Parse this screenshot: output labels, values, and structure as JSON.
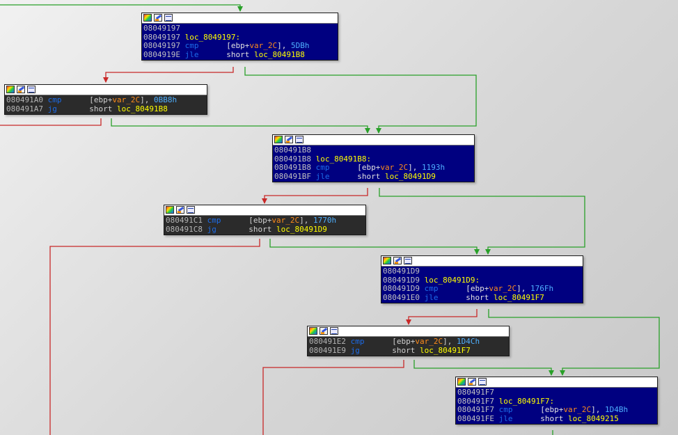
{
  "colors": {
    "true_edge": "#28a028",
    "false_edge": "#c82828",
    "node_blue": "#000080",
    "node_dark": "#2b2b2b"
  },
  "icons": [
    "graph-color-icon",
    "edit-node-icon",
    "node-text-icon"
  ],
  "nodes": [
    {
      "lines": [
        {
          "addr": "08049197"
        },
        {
          "addr": "08049197",
          "label": "loc_8049197:"
        },
        {
          "addr": "08049197",
          "mnem": "cmp",
          "pad": "      ",
          "pre": "[ebp+",
          "var": "var_2C",
          "post": "], ",
          "num": "5DBh"
        },
        {
          "addr": "0804919E",
          "mnem": "jle",
          "pad": "      ",
          "pre": "short ",
          "target": "loc_80491B8"
        }
      ]
    },
    {
      "lines": [
        {
          "addr": "080491A0",
          "mnem": "cmp",
          "pad": "      ",
          "pre": "[ebp+",
          "var": "var_2C",
          "post": "], ",
          "num": "0BB8h"
        },
        {
          "addr": "080491A7",
          "mnem": "jg",
          "pad": "       ",
          "pre": "short ",
          "target": "loc_80491B8"
        }
      ]
    },
    {
      "lines": [
        {
          "addr": "080491B8"
        },
        {
          "addr": "080491B8",
          "label": "loc_80491B8:"
        },
        {
          "addr": "080491B8",
          "mnem": "cmp",
          "pad": "      ",
          "pre": "[ebp+",
          "var": "var_2C",
          "post": "], ",
          "num": "1193h"
        },
        {
          "addr": "080491BF",
          "mnem": "jle",
          "pad": "      ",
          "pre": "short ",
          "target": "loc_80491D9"
        }
      ]
    },
    {
      "lines": [
        {
          "addr": "080491C1",
          "mnem": "cmp",
          "pad": "      ",
          "pre": "[ebp+",
          "var": "var_2C",
          "post": "], ",
          "num": "1770h"
        },
        {
          "addr": "080491C8",
          "mnem": "jg",
          "pad": "       ",
          "pre": "short ",
          "target": "loc_80491D9"
        }
      ]
    },
    {
      "lines": [
        {
          "addr": "080491D9"
        },
        {
          "addr": "080491D9",
          "label": "loc_80491D9:"
        },
        {
          "addr": "080491D9",
          "mnem": "cmp",
          "pad": "      ",
          "pre": "[ebp+",
          "var": "var_2C",
          "post": "], ",
          "num": "176Fh"
        },
        {
          "addr": "080491E0",
          "mnem": "jle",
          "pad": "      ",
          "pre": "short ",
          "target": "loc_80491F7"
        }
      ]
    },
    {
      "lines": [
        {
          "addr": "080491E2",
          "mnem": "cmp",
          "pad": "      ",
          "pre": "[ebp+",
          "var": "var_2C",
          "post": "], ",
          "num": "1D4Ch"
        },
        {
          "addr": "080491E9",
          "mnem": "jg",
          "pad": "       ",
          "pre": "short ",
          "target": "loc_80491F7"
        }
      ]
    },
    {
      "lines": [
        {
          "addr": "080491F7"
        },
        {
          "addr": "080491F7",
          "label": "loc_80491F7:"
        },
        {
          "addr": "080491F7",
          "mnem": "cmp",
          "pad": "      ",
          "pre": "[ebp+",
          "var": "var_2C",
          "post": "], ",
          "num": "1D4Bh"
        },
        {
          "addr": "080491FE",
          "mnem": "jle",
          "pad": "      ",
          "pre": "short ",
          "target": "loc_8049215"
        }
      ]
    }
  ]
}
